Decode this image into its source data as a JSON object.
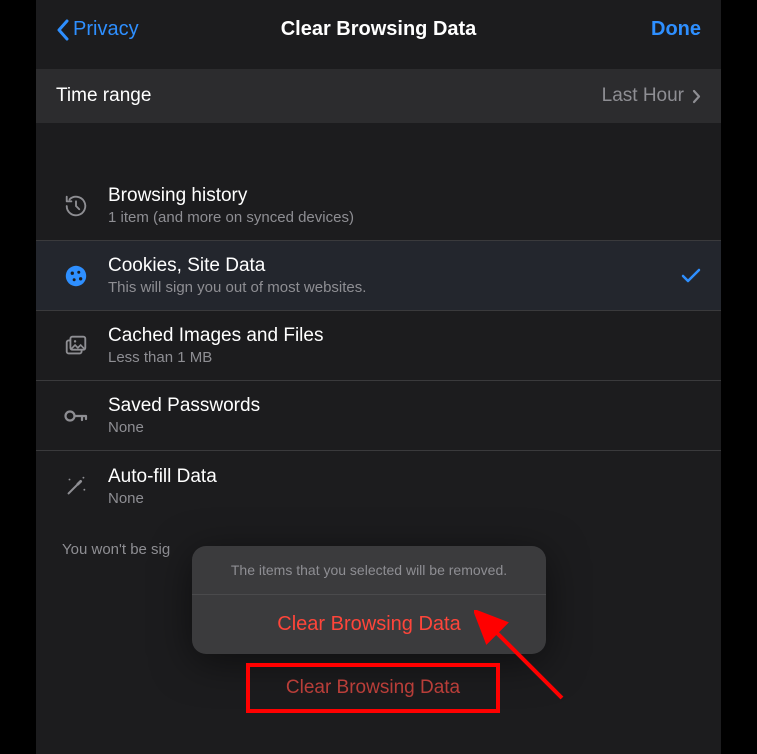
{
  "header": {
    "back_label": "Privacy",
    "title": "Clear Browsing Data",
    "done_label": "Done"
  },
  "time_range": {
    "label": "Time range",
    "value": "Last Hour"
  },
  "options": {
    "browsing_history": {
      "title": "Browsing history",
      "subtitle": "1 item (and more on synced devices)"
    },
    "cookies": {
      "title": "Cookies, Site Data",
      "subtitle": "This will sign you out of most websites."
    },
    "cached": {
      "title": "Cached Images and Files",
      "subtitle": "Less than 1 MB"
    },
    "passwords": {
      "title": "Saved Passwords",
      "subtitle": "None"
    },
    "autofill": {
      "title": "Auto-fill Data",
      "subtitle": "None"
    }
  },
  "footer_text": "You won't be sig",
  "action_sheet": {
    "message": "The items that you selected will be removed.",
    "button": "Clear Browsing Data"
  },
  "bottom_button": "Clear Browsing Data"
}
